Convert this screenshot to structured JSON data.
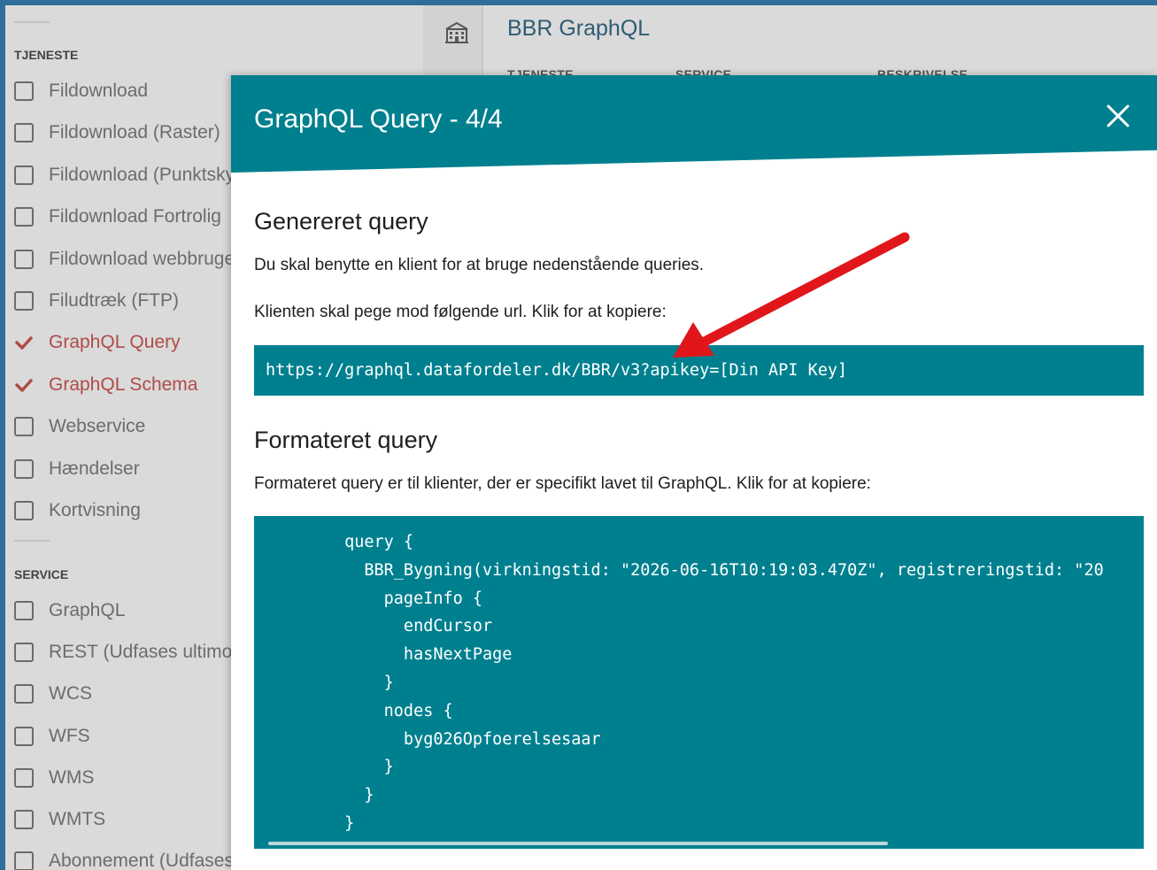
{
  "colors": {
    "accent": "#00808f",
    "selected": "#b04b47",
    "arrow": "#e0161b"
  },
  "background": {
    "page_title": "BBR GraphQL",
    "icon": "building-icon",
    "columns": [
      "TJENESTE",
      "SERVICE",
      "BESKRIVELSE"
    ],
    "filters": {
      "tjeneste_heading": "TJENESTE",
      "tjeneste": [
        {
          "label": "Fildownload",
          "checked": false
        },
        {
          "label": "Fildownload (Raster)",
          "checked": false
        },
        {
          "label": "Fildownload (Punktsky",
          "checked": false
        },
        {
          "label": "Fildownload Fortrolig",
          "checked": false
        },
        {
          "label": "Fildownload webbruge",
          "checked": false
        },
        {
          "label": "Filudtræk (FTP)",
          "checked": false
        },
        {
          "label": "GraphQL Query",
          "checked": true
        },
        {
          "label": "GraphQL Schema",
          "checked": true
        },
        {
          "label": "Webservice",
          "checked": false
        },
        {
          "label": "Hændelser",
          "checked": false
        },
        {
          "label": "Kortvisning",
          "checked": false
        }
      ],
      "service_heading": "SERVICE",
      "service": [
        {
          "label": "GraphQL",
          "checked": false
        },
        {
          "label": "REST (Udfases ultimo",
          "checked": false
        },
        {
          "label": "WCS",
          "checked": false
        },
        {
          "label": "WFS",
          "checked": false
        },
        {
          "label": "WMS",
          "checked": false
        },
        {
          "label": "WMTS",
          "checked": false
        },
        {
          "label": "Abonnement (Udfases",
          "checked": false
        }
      ]
    }
  },
  "modal": {
    "title": "GraphQL Query - 4/4",
    "close_icon": "close-icon",
    "generated": {
      "heading": "Genereret query",
      "text1": "Du skal benytte en klient for at bruge nedenstående queries.",
      "text2": "Klienten skal pege mod følgende url. Klik for at kopiere:",
      "url": "https://graphql.datafordeler.dk/BBR/v3?apikey=[Din API Key]"
    },
    "formatted": {
      "heading": "Formateret query",
      "text": "Formateret query er til klienter, der er specifikt lavet til GraphQL. Klik for at kopiere:",
      "code": [
        "        query {",
        "          BBR_Bygning(virkningstid: \"2026-06-16T10:19:03.470Z\", registreringstid: \"20",
        "            pageInfo {",
        "              endCursor",
        "              hasNextPage",
        "            }",
        "            nodes {",
        "              byg026Opfoerelsesaar",
        "            }",
        "          }",
        "        }"
      ]
    }
  }
}
